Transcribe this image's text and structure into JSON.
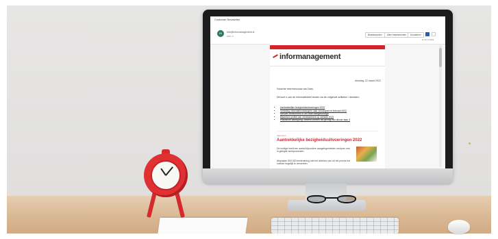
{
  "email": {
    "window_title": "Customer Newsletter",
    "avatar_initials": "IN",
    "sender": "Info@informanagement.nl",
    "sender_sub": "Aan: U",
    "actions": [
      "Beantwoorden",
      "Allen beantwoorden",
      "Doorsturen"
    ],
    "received": "Di 22-3-2022",
    "brand": "informanagement",
    "date": "dinsdag, 22 maart 2022",
    "greeting": "Geachte heer/mevrouw van Dam,",
    "intro": "Dit kunt u van de informatiebrief vinden via de volgende artikelen / diensten:",
    "items": [
      "Aantrekkelijke bezigheidsuitvoeringen 2022",
      "Verdeling informatieontvangers naar verschijnen in februari 2022",
      "Nieuwe werknemers in het team aangekondigd",
      "Bijwerken profiel van medewerkers op website 2022",
      "Praktische aanwijzing: Bekend worden als gevolg van uitvoer fase 3"
    ],
    "section_label": "Algemeen",
    "headline": "Aantrekkelijke bezigheidsuitvoeringen 2022",
    "body1": "De huidige heeft een aantal bijzondere aangelegenheden verlopen met in gelegde werkprocessen.",
    "body2": "Afspraken 500 000 bestemming met het afvinken van uit het proces het snelste mogelijk te verwerken."
  },
  "colors": {
    "accent_red": "#d7242b",
    "avatar_green": "#2d7a5c",
    "action_blue": "#2a5db0",
    "clock_red": "#e03033"
  },
  "icons": [
    "avatar-icon",
    "scrollbar",
    "clock-icon",
    "glasses-icon"
  ]
}
